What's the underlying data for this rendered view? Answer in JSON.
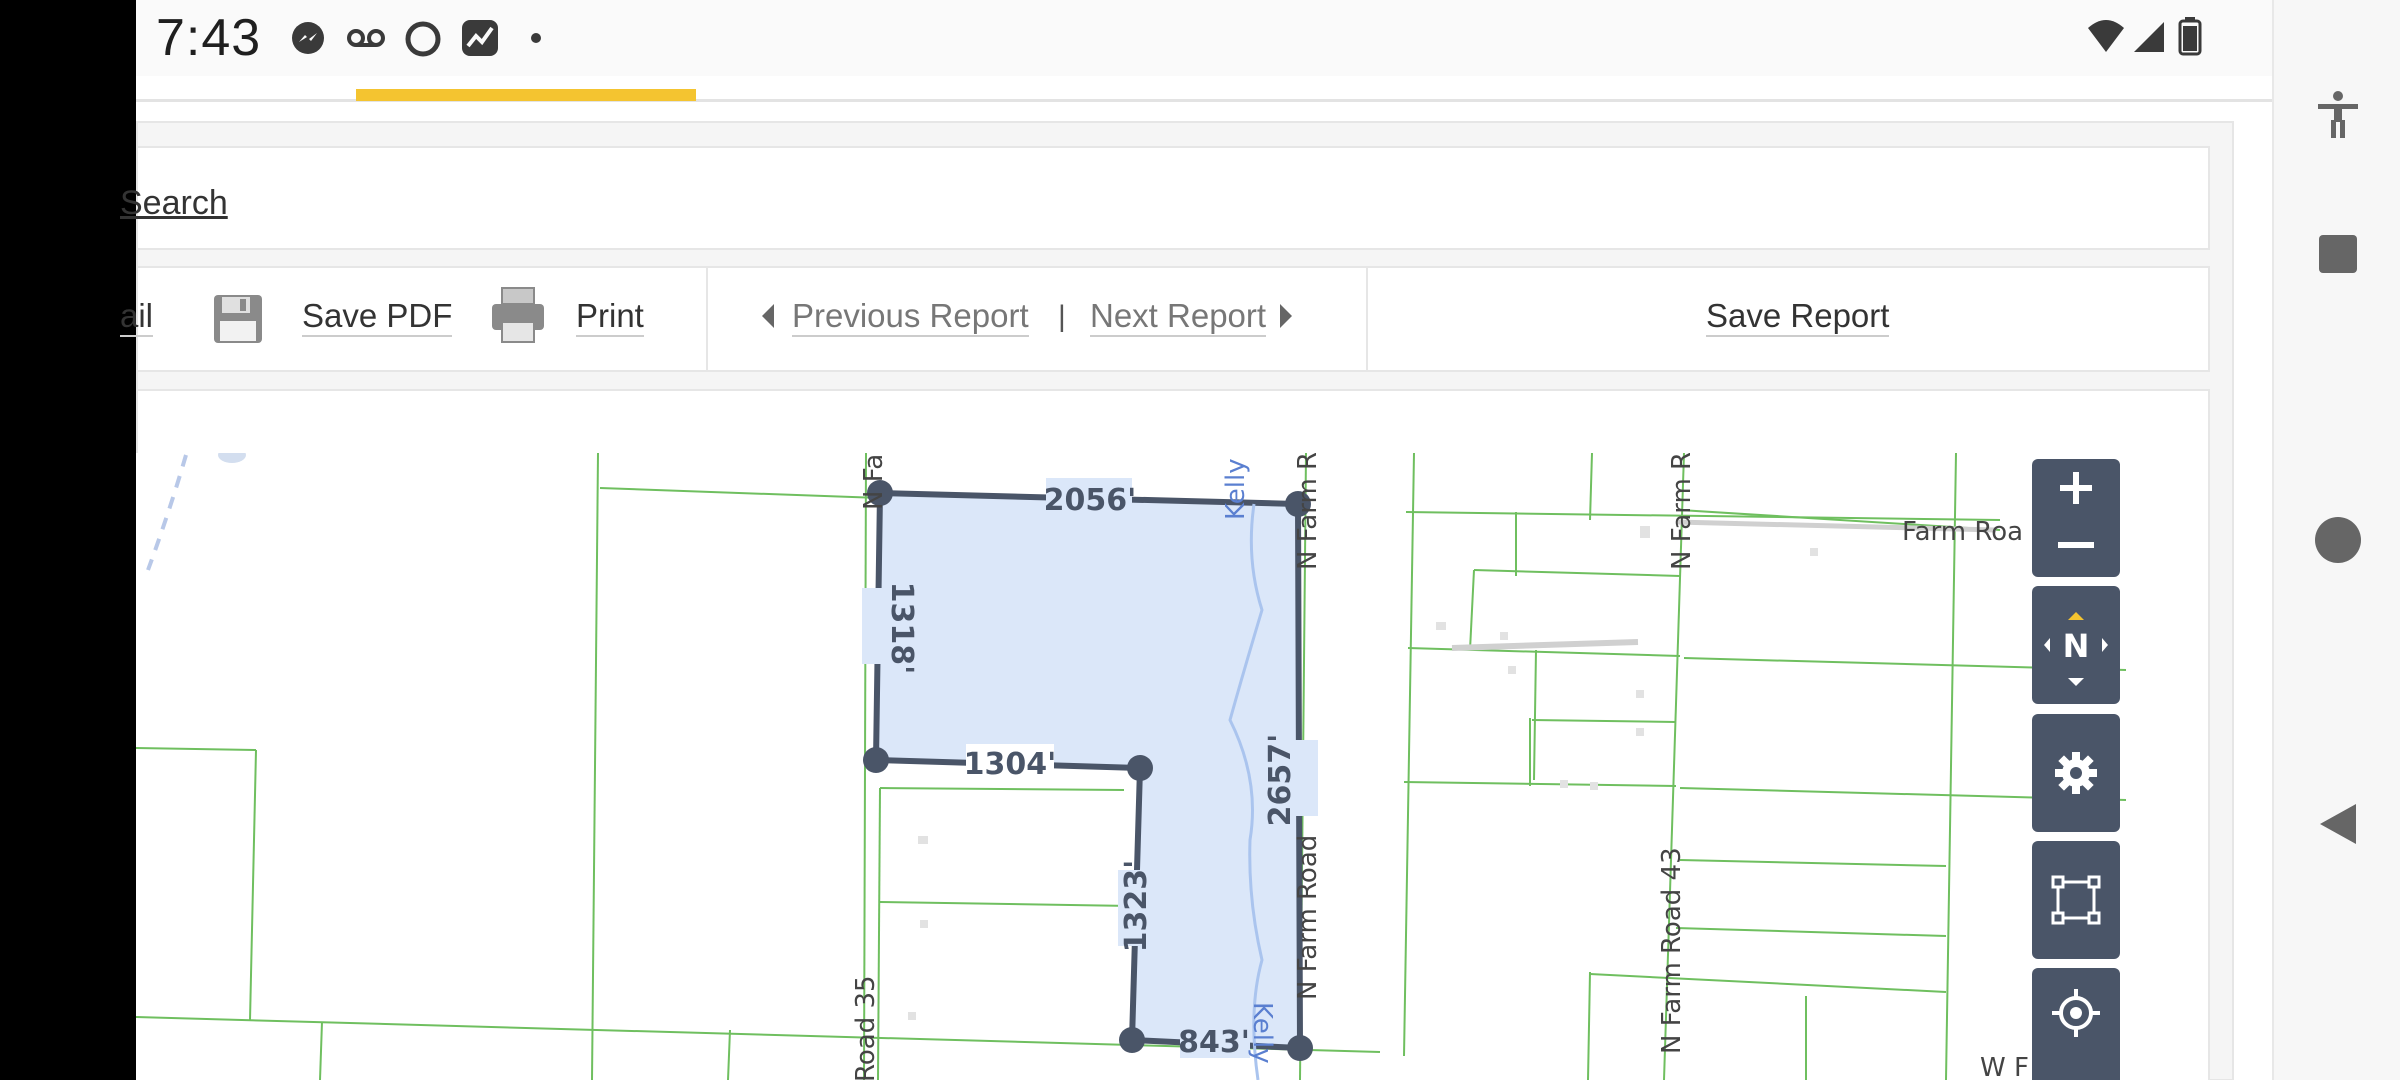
{
  "status": {
    "time": "7:43",
    "icons": [
      "messenger-icon",
      "voicemail-icon",
      "circle-app-icon",
      "chart-app-icon",
      "dot-icon",
      "wifi-icon",
      "signal-icon",
      "battery-icon"
    ]
  },
  "search": {
    "link_label": "Search"
  },
  "toolbar": {
    "email_label": "ail",
    "save_pdf_label": "Save PDF",
    "print_label": "Print",
    "previous_report_label": "Previous Report",
    "separator": "|",
    "next_report_label": "Next Report",
    "save_report_label": "Save Report"
  },
  "map": {
    "measurements": {
      "top": "2056'",
      "left": "1318'",
      "middle": "1304'",
      "right": "2657'",
      "inner": "1323'",
      "bottom": "843'"
    },
    "labels": {
      "kelly_top": "Kelly",
      "kelly_bottom": "Kelly",
      "farm_road": "Farm Roa",
      "n_farm_r": "N Farm R",
      "n_farm_road_43": "N Farm Road 43",
      "n_farm_road": "N Farm Road",
      "n_farm_top": "N Farm R",
      "n_fa": "N Fa",
      "road_35": "Road 35",
      "w_f": "W F"
    },
    "controls": {
      "compass_label": "N"
    },
    "colors": {
      "parcel_fill": "#dbe7f9",
      "parcel_stroke": "#4a5568",
      "parcel_lines": "#6fbf5f",
      "water": "#6c8fd6"
    }
  },
  "nav": {
    "items": [
      "accessibility-icon",
      "recents-icon",
      "home-icon",
      "back-icon"
    ]
  }
}
